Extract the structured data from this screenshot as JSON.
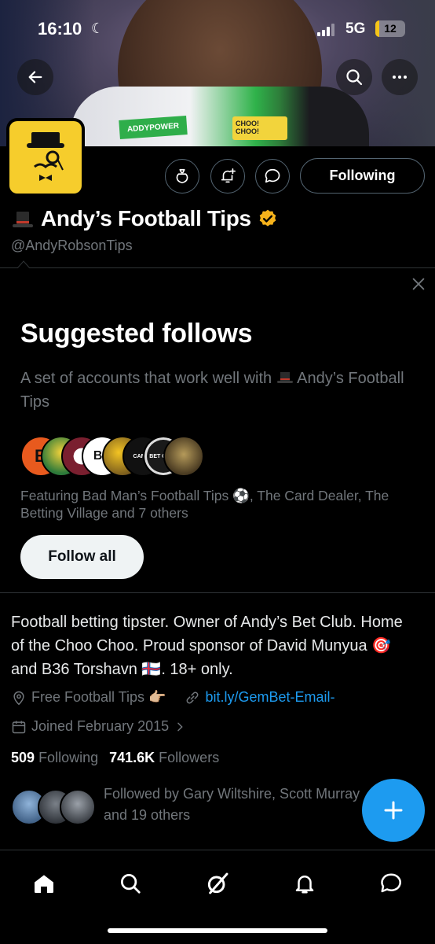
{
  "status_bar": {
    "time": "16:10",
    "network": "5G",
    "battery": "12",
    "battery_level": 0.12
  },
  "profile": {
    "display_name": "Andy’s Football Tips",
    "handle": "@AndyRobsonTips",
    "following_button": "Following",
    "bio": "Football betting tipster. Owner of Andy’s Bet Club. Home of the Choo Choo. Proud sponsor of David Munyua 🎯 and B36 Torshavn 🇫🇴. 18+ only.",
    "location": "Free Football Tips 👉🏼",
    "website": "bit.ly/GemBet-Email-",
    "joined": "Joined February 2015",
    "following_count": "509",
    "following_label": "Following",
    "followers_count": "741.6K",
    "followers_label": "Followers",
    "followed_by": "Followed by Gary Wiltshire, Scott Murray and 19 others"
  },
  "banner": {
    "sponsor_text": "ADDYPOWER",
    "choo_text": "CHOO! CHOO!"
  },
  "suggested": {
    "title": "Suggested follows",
    "subtitle_prefix": "A set of accounts that work well with",
    "subtitle_name": "Andy’s Football Tips",
    "featuring": "Featuring Bad Man’s Football Tips ⚽, The Card Dealer, The Betting Village and 7 others",
    "follow_all": "Follow all",
    "avatar_labels": [
      "BS",
      "CARDS",
      "BET CLUB"
    ]
  },
  "colors": {
    "accent": "#1d9bf0",
    "verified_gold": "#f5b21b",
    "avatar_yellow": "#f6cd2c"
  },
  "icons": {
    "back": "back-arrow-icon",
    "search": "search-icon",
    "more": "more-icon",
    "money_bag": "money-bag-icon",
    "notify": "bell-plus-icon",
    "message": "message-icon",
    "nav": [
      "home-icon",
      "search-icon",
      "grok-icon",
      "bell-icon",
      "messages-icon"
    ]
  }
}
